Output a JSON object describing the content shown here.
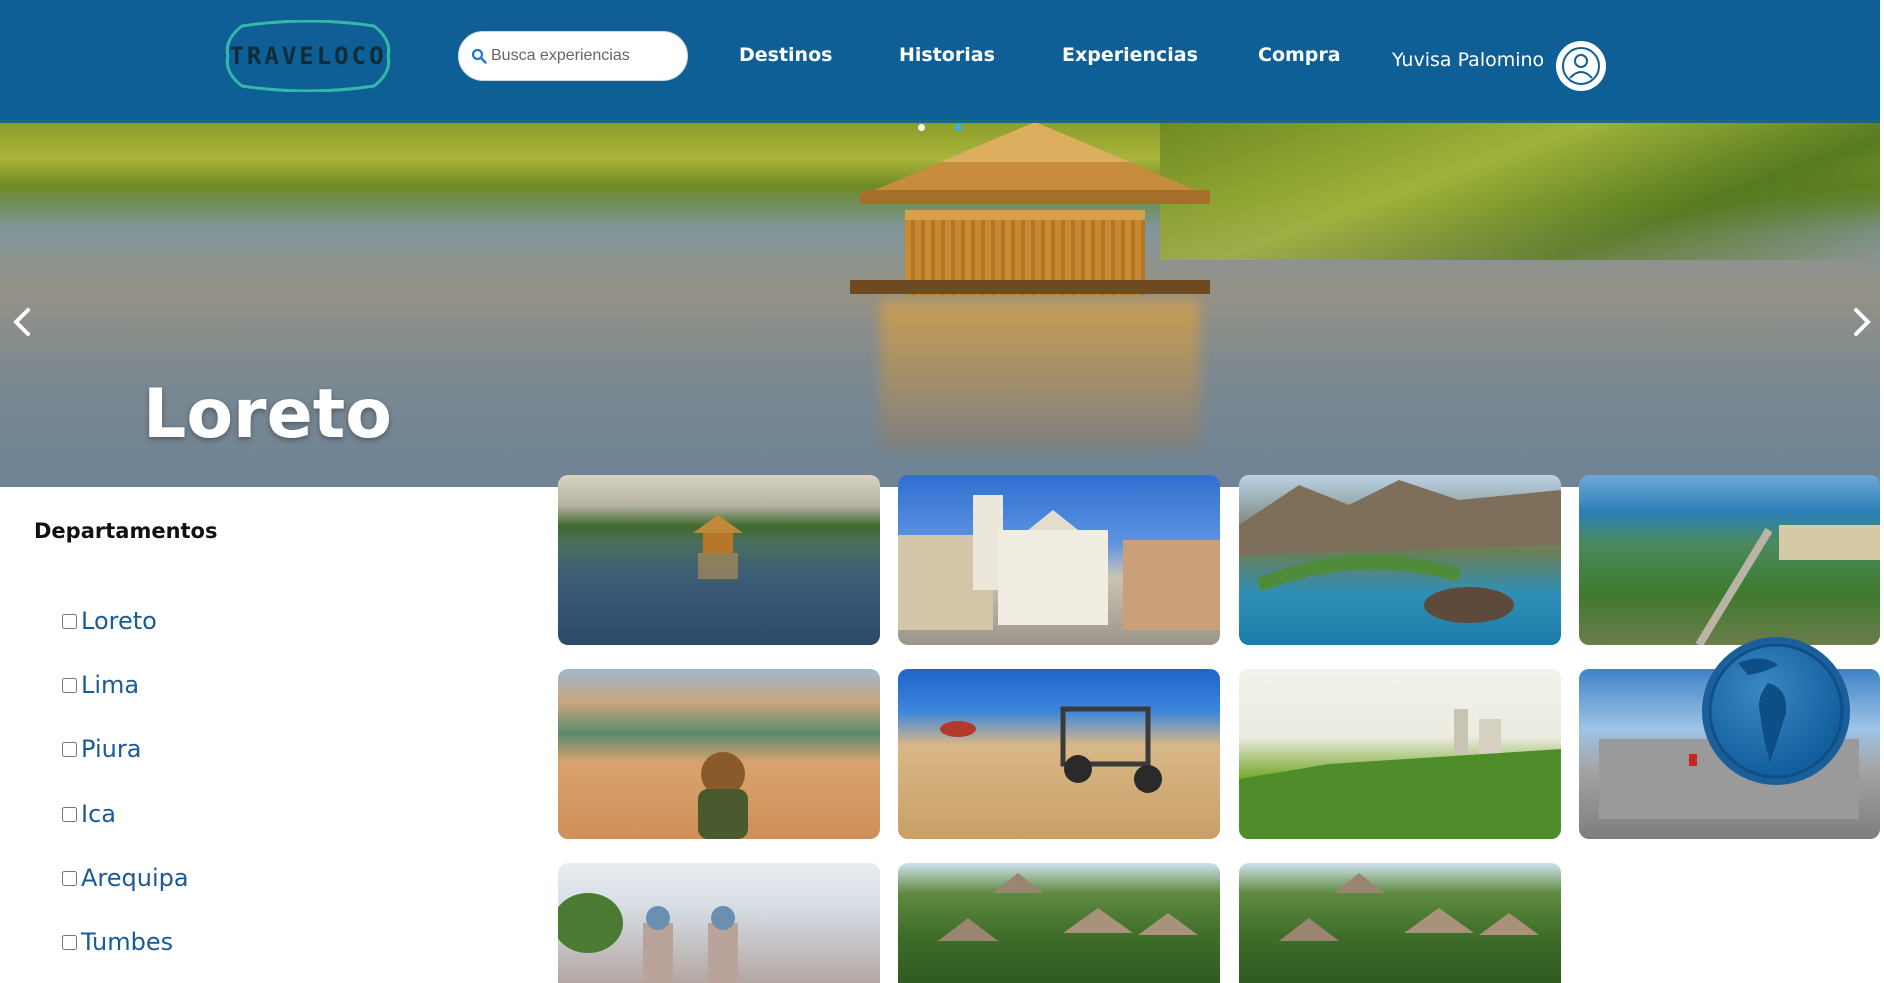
{
  "brand": {
    "logo_text": "TRAVELOCO"
  },
  "search": {
    "placeholder": "Busca experiencias",
    "value": ""
  },
  "nav": {
    "destinos": "Destinos",
    "historias": "Historias",
    "experiencias": "Experiencias",
    "compra": "Compra"
  },
  "user": {
    "name": "Yuvisa Palomino",
    "icon": "user-circle-icon"
  },
  "hero": {
    "title": "Loreto",
    "slide_dots": 2,
    "active_dot": 2,
    "prev_icon": "chevron-left-icon",
    "next_icon": "chevron-right-icon"
  },
  "filters": {
    "title": "Departamentos",
    "items": [
      {
        "label": "Loreto",
        "checked": false
      },
      {
        "label": "Lima",
        "checked": false
      },
      {
        "label": "Piura",
        "checked": false
      },
      {
        "label": "Ica",
        "checked": false
      },
      {
        "label": "Arequipa",
        "checked": false
      },
      {
        "label": "Tumbes",
        "checked": false
      }
    ]
  },
  "colors": {
    "topbar": "#0f5f96",
    "link": "#1a5a98",
    "dot_active": "#29b6f6",
    "dot_inactive": "#ffffff"
  },
  "gallery_icons": [
    "stilt-house-lake-photo",
    "cathedral-plaza-photo",
    "coastal-bay-aerial-photo",
    "resort-aerial-photo",
    "desert-oasis-photo",
    "dune-buggy-photo",
    "green-cliff-coast-photo",
    "government-palace-photo",
    "church-towers-photo",
    "jungle-lodge-photo",
    "jungle-lodge-photo-2"
  ],
  "floating": {
    "globe_icon": "globe-icon"
  }
}
